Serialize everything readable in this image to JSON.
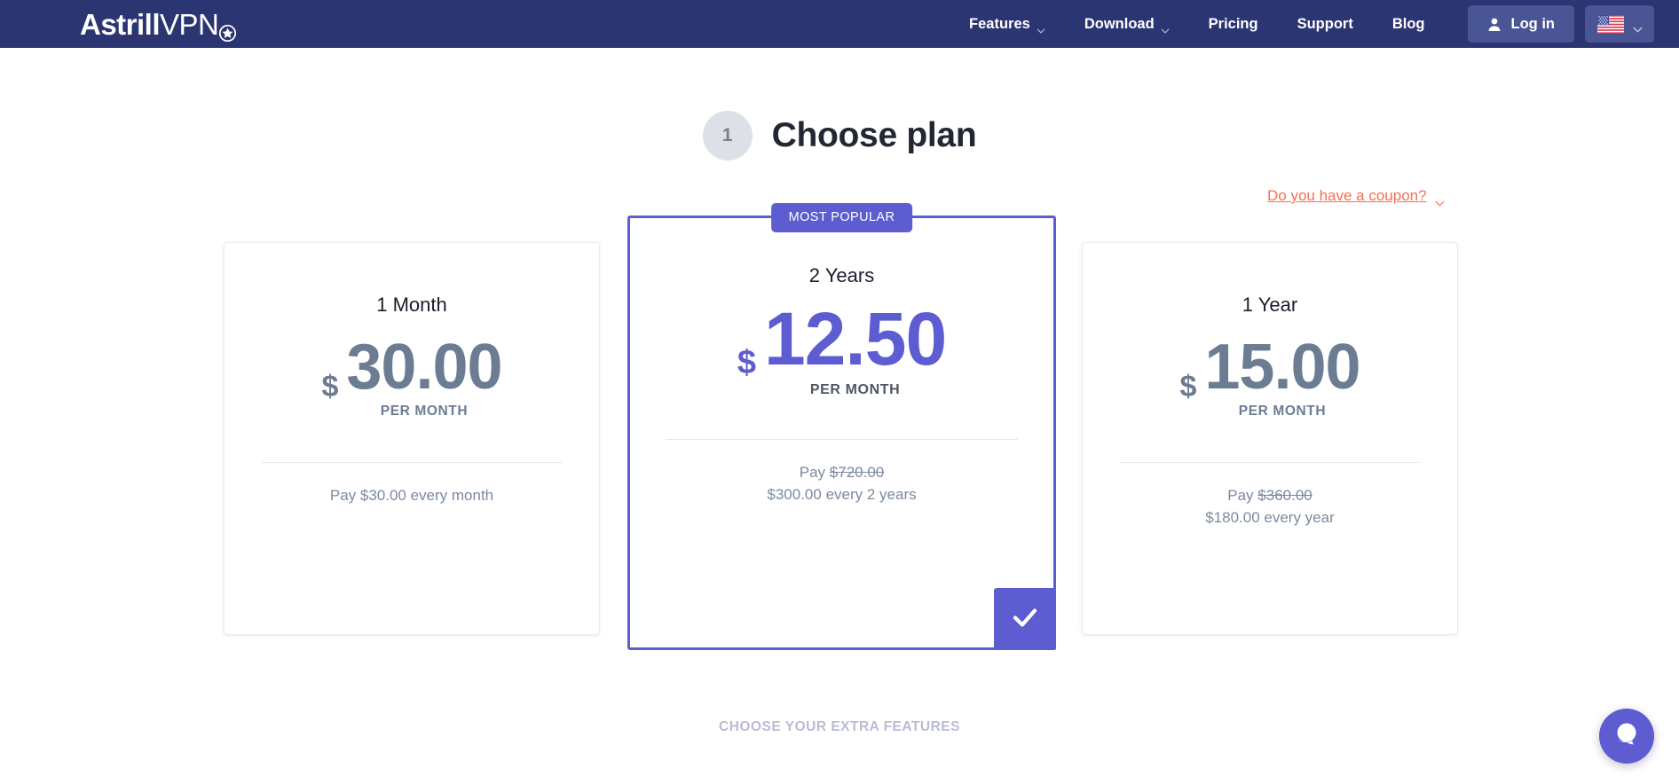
{
  "header": {
    "logo": {
      "primary": "Astrill",
      "secondary": "VPN",
      "icon": "star-badge-icon"
    },
    "nav": [
      {
        "label": "Features",
        "has_dropdown": true
      },
      {
        "label": "Download",
        "has_dropdown": true
      },
      {
        "label": "Pricing",
        "has_dropdown": false
      },
      {
        "label": "Support",
        "has_dropdown": false
      },
      {
        "label": "Blog",
        "has_dropdown": false
      }
    ],
    "login_label": "Log in",
    "language": {
      "flag": "us-flag-icon",
      "has_dropdown": true
    },
    "bg_color": "#2b3572",
    "button_color": "#4a5596"
  },
  "page": {
    "step_number": "1",
    "title": "Choose plan",
    "coupon_label": "Do you have a coupon?",
    "coupon_color": "#f96e52",
    "extra_features_label": "CHOOSE YOUR EXTRA FEATURES"
  },
  "plans": {
    "accent_color": "#5d5cd0",
    "muted_color": "#6b7c93",
    "badge_label": "MOST POPULAR",
    "items": [
      {
        "id": "plan-1-month",
        "name": "1 Month",
        "currency": "$",
        "amount": "30.00",
        "per_label": "PER MONTH",
        "pay_prefix": "Pay $30.00 every month",
        "original_price": "",
        "billing_note": "",
        "featured": false,
        "selected": false
      },
      {
        "id": "plan-2-years",
        "name": "2 Years",
        "currency": "$",
        "amount": "12.50",
        "per_label": "PER MONTH",
        "pay_prefix": "Pay ",
        "original_price": "$720.00",
        "billing_note": "$300.00 every 2 years",
        "featured": true,
        "selected": true
      },
      {
        "id": "plan-1-year",
        "name": "1 Year",
        "currency": "$",
        "amount": "15.00",
        "per_label": "PER MONTH",
        "pay_prefix": "Pay ",
        "original_price": "$360.00",
        "billing_note": "$180.00 every year",
        "featured": false,
        "selected": false
      }
    ]
  },
  "chat": {
    "icon": "chat-bubble-icon",
    "color": "#5d5cd0"
  }
}
